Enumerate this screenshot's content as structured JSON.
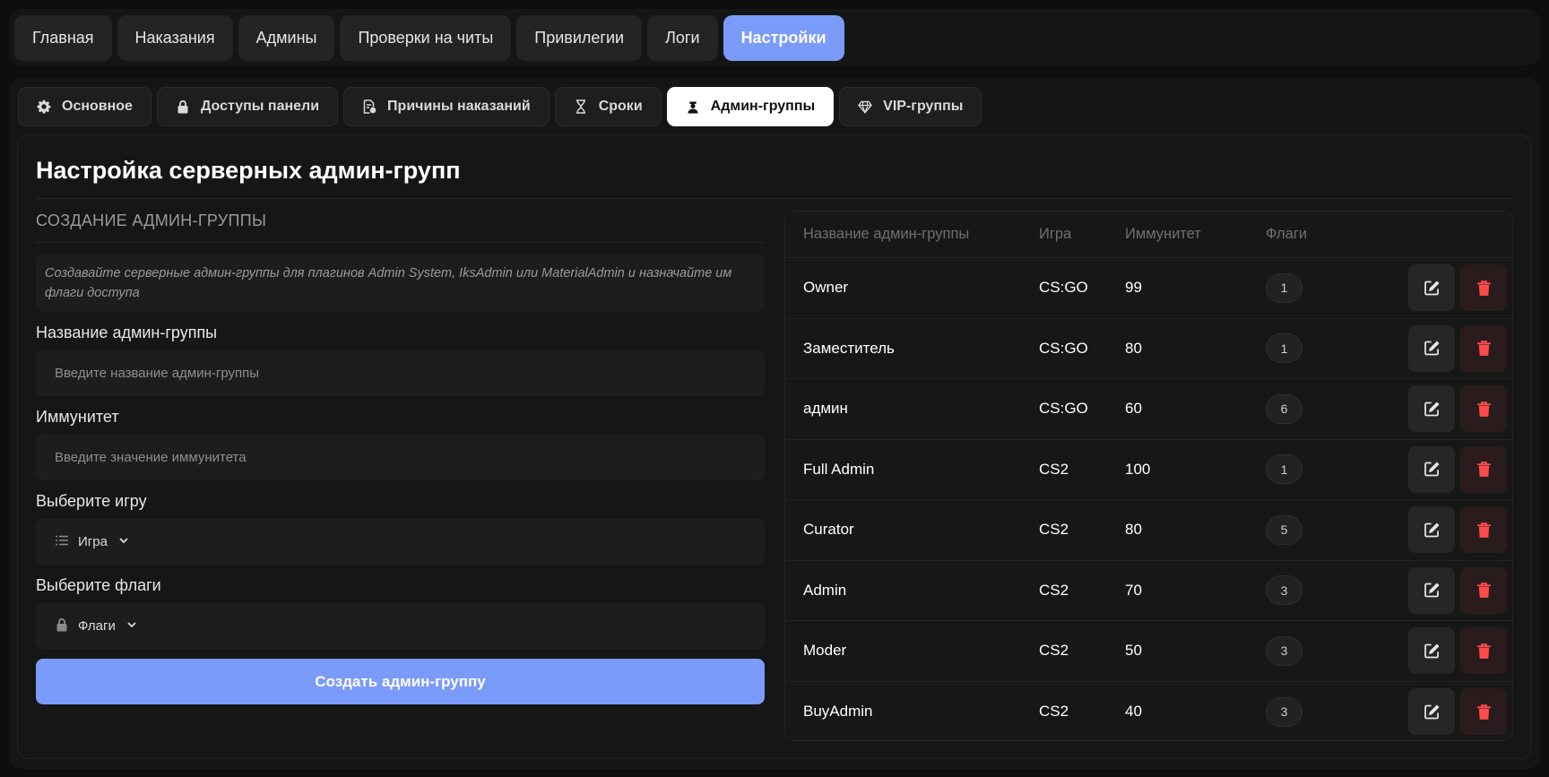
{
  "topnav": {
    "items": [
      {
        "label": "Главная",
        "active": false
      },
      {
        "label": "Наказания",
        "active": false
      },
      {
        "label": "Админы",
        "active": false
      },
      {
        "label": "Проверки на читы",
        "active": false
      },
      {
        "label": "Привилегии",
        "active": false
      },
      {
        "label": "Логи",
        "active": false
      },
      {
        "label": "Настройки",
        "active": true
      }
    ]
  },
  "subtabs": {
    "items": [
      {
        "label": "Основное",
        "icon": "gear-icon"
      },
      {
        "label": "Доступы панели",
        "icon": "lock-icon"
      },
      {
        "label": "Причины наказаний",
        "icon": "document-icon"
      },
      {
        "label": "Сроки",
        "icon": "hourglass-icon"
      },
      {
        "label": "Админ-группы",
        "icon": "user-shield-icon",
        "active": true
      },
      {
        "label": "VIP-группы",
        "icon": "diamond-icon"
      }
    ]
  },
  "page": {
    "title": "Настройка серверных админ-групп"
  },
  "form": {
    "section_label": "СОЗДАНИЕ АДМИН-ГРУППЫ",
    "hint": "Создавайте серверные админ-группы для плагинов Admin System, IksAdmin или MaterialAdmin и назначайте им флаги доступа",
    "name_label": "Название админ-группы",
    "name_placeholder": "Введите название админ-группы",
    "immunity_label": "Иммунитет",
    "immunity_placeholder": "Введите значение иммунитета",
    "game_label": "Выберите игру",
    "game_select": "Игра",
    "flags_label": "Выберите флаги",
    "flags_select": "Флаги",
    "create_button": "Создать админ-группу"
  },
  "table": {
    "headers": {
      "name": "Название админ-группы",
      "game": "Игра",
      "immunity": "Иммунитет",
      "flags": "Флаги"
    },
    "rows": [
      {
        "name": "Owner",
        "game": "CS:GO",
        "immunity": "99",
        "flags": "1"
      },
      {
        "name": "Заместитель",
        "game": "CS:GO",
        "immunity": "80",
        "flags": "1"
      },
      {
        "name": "админ",
        "game": "CS:GO",
        "immunity": "60",
        "flags": "6"
      },
      {
        "name": "Full Admin",
        "game": "CS2",
        "immunity": "100",
        "flags": "1"
      },
      {
        "name": "Curator",
        "game": "CS2",
        "immunity": "80",
        "flags": "5"
      },
      {
        "name": "Admin",
        "game": "CS2",
        "immunity": "70",
        "flags": "3"
      },
      {
        "name": "Moder",
        "game": "CS2",
        "immunity": "50",
        "flags": "3"
      },
      {
        "name": "BuyAdmin",
        "game": "CS2",
        "immunity": "40",
        "flags": "3"
      }
    ]
  },
  "colors": {
    "accent": "#7b9bfa",
    "delete": "#ff4b4b",
    "background": "#0e0e0e",
    "surface": "#151515"
  }
}
